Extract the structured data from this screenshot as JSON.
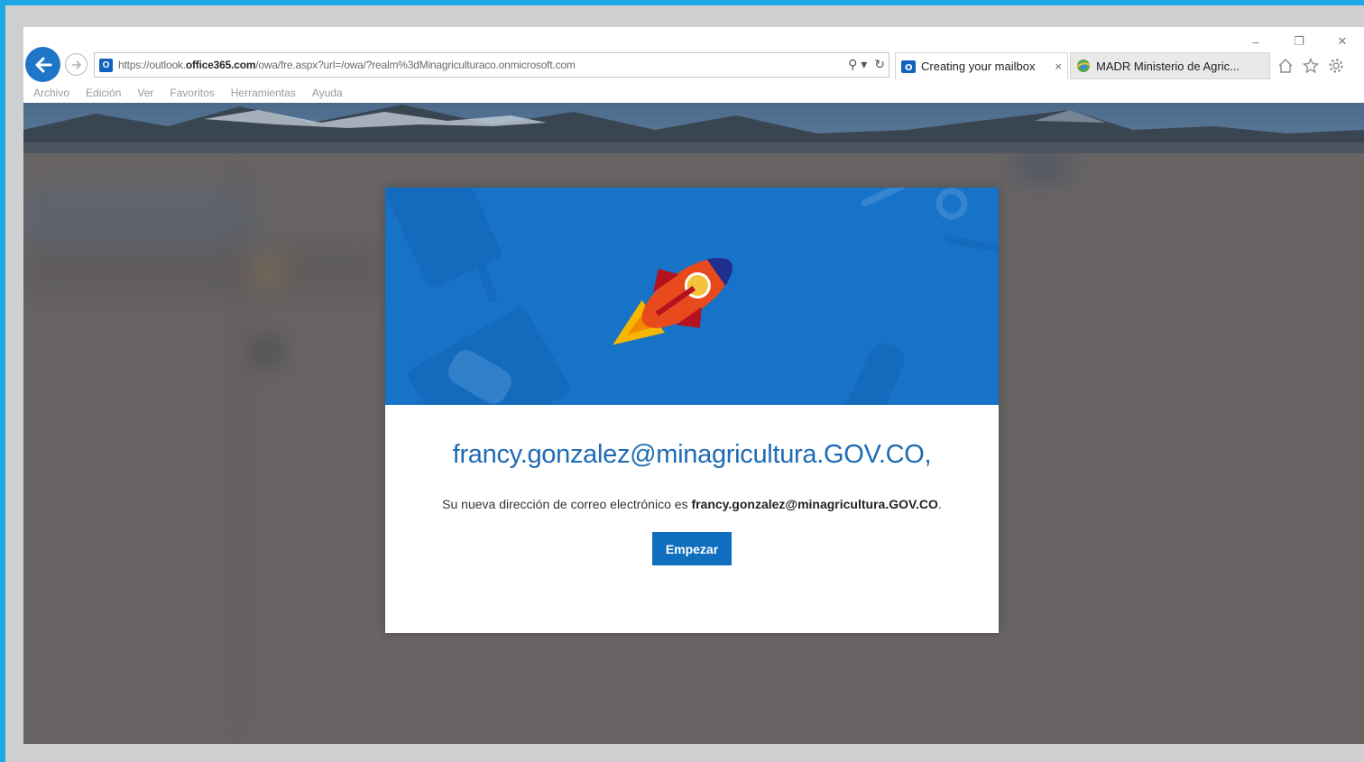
{
  "browser": {
    "url_prefix": "https://outlook.",
    "url_domain": "office365.com",
    "url_path": "/owa/fre.aspx?url=/owa/?realm%3dMinagriculturaco.onmicrosoft.com",
    "tabs": [
      {
        "label": "Creating your mailbox",
        "active": true,
        "close": "×"
      },
      {
        "label": "MADR Ministerio de Agric...",
        "active": false
      }
    ],
    "window_controls": {
      "minimize": "–",
      "restore": "❐",
      "close": "✕"
    },
    "toolbar_icons": [
      "home-icon",
      "favorites-star-icon",
      "settings-gear-icon"
    ],
    "search_glyph": "⚲ ▾",
    "refresh_glyph": "↻",
    "menu": [
      "Archivo",
      "Edición",
      "Ver",
      "Favoritos",
      "Herramientas",
      "Ayuda"
    ]
  },
  "dialog": {
    "title": "francy.gonzalez@minagricultura.GOV.CO,",
    "message_prefix": "Su nueva dirección de correo electrónico es ",
    "message_email": "francy.gonzalez@minagricultura.GOV.CO",
    "message_suffix": ".",
    "button_label": "Empezar",
    "hero_icon": "rocket-icon"
  },
  "colors": {
    "outer_border": "#1ea7e6",
    "page_overlay": "#686464",
    "hero_blue": "#1773c8",
    "title_blue": "#1e6bb5",
    "button_blue": "#106ebe",
    "back_button": "#1f76c9"
  }
}
